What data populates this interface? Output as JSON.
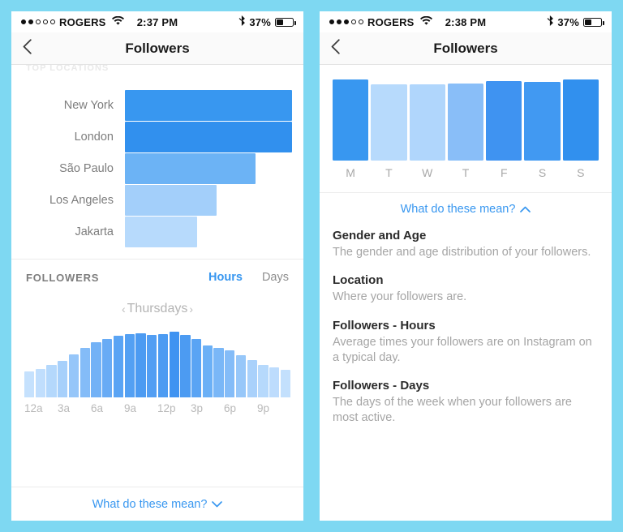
{
  "background_color": "#7ed8f2",
  "accent_color": "#3897f0",
  "left_phone": {
    "status_bar": {
      "carrier": "ROGERS",
      "signal_dots_filled": 2,
      "signal_dots_total": 5,
      "wifi_icon": "wifi-icon",
      "time": "2:37 PM",
      "bluetooth_icon": "bluetooth-icon",
      "battery_percent": "37%"
    },
    "nav": {
      "back_icon": "chevron-left-icon",
      "title": "Followers"
    },
    "cut_heading": "TOP LOCATIONS",
    "locations_section": {
      "rows": [
        {
          "label": "New York",
          "value": 100,
          "color": "#3897f0"
        },
        {
          "label": "London",
          "value": 100,
          "color": "#3190ee"
        },
        {
          "label": "São Paulo",
          "value": 78,
          "color": "#6cb3f5"
        },
        {
          "label": "Los Angeles",
          "value": 55,
          "color": "#a3cffa"
        },
        {
          "label": "Jakarta",
          "value": 43,
          "color": "#b7dafc"
        }
      ]
    },
    "followers_section": {
      "title": "FOLLOWERS",
      "tabs": [
        {
          "label": "Hours",
          "active": true
        },
        {
          "label": "Days",
          "active": false
        }
      ],
      "day_selector": {
        "prev_icon": "chevron-left-icon",
        "label": "Thursdays",
        "next_icon": "chevron-right-icon"
      }
    },
    "expander": {
      "label": "What do these mean?",
      "caret_icon": "chevron-down-icon",
      "caret": "⌄"
    }
  },
  "right_phone": {
    "status_bar": {
      "carrier": "ROGERS",
      "signal_dots_filled": 3,
      "signal_dots_total": 5,
      "wifi_icon": "wifi-icon",
      "time": "2:38 PM",
      "bluetooth_icon": "bluetooth-icon",
      "battery_percent": "37%"
    },
    "nav": {
      "back_icon": "chevron-left-icon",
      "title": "Followers"
    },
    "expander": {
      "label": "What do these mean?",
      "caret_icon": "chevron-up-icon",
      "caret": "⌃"
    },
    "glossary": [
      {
        "term": "Gender and Age",
        "definition": "The gender and age distribution of your followers."
      },
      {
        "term": "Location",
        "definition": "Where your followers are."
      },
      {
        "term": "Followers - Hours",
        "definition": "Average times your followers are on Instagram on a typical day."
      },
      {
        "term": "Followers - Days",
        "definition": "The days of the week when your followers are most active."
      }
    ]
  },
  "chart_data": [
    {
      "type": "bar",
      "title": "TOP LOCATIONS",
      "orientation": "horizontal",
      "categories": [
        "New York",
        "London",
        "São Paulo",
        "Los Angeles",
        "Jakarta"
      ],
      "values": [
        100,
        100,
        78,
        55,
        43
      ],
      "colors": [
        "#3897f0",
        "#3190ee",
        "#6cb3f5",
        "#a3cffa",
        "#b7dafc"
      ],
      "xlabel": "",
      "ylabel": "",
      "xlim": [
        0,
        100
      ],
      "grid": false,
      "legend": false
    },
    {
      "type": "bar",
      "title": "FOLLOWERS — Hours",
      "subtitle": "Thursdays",
      "x": [
        "12a",
        "1a",
        "2a",
        "3a",
        "4a",
        "5a",
        "6a",
        "7a",
        "8a",
        "9a",
        "10a",
        "11a",
        "12p",
        "1p",
        "2p",
        "3p",
        "4p",
        "5p",
        "6p",
        "7p",
        "8p",
        "9p",
        "10p",
        "11p"
      ],
      "tick_labels": [
        "12a",
        "3a",
        "6a",
        "9a",
        "12p",
        "3p",
        "6p",
        "9p"
      ],
      "values": [
        35,
        38,
        43,
        49,
        58,
        66,
        74,
        78,
        83,
        85,
        86,
        84,
        85,
        88,
        84,
        78,
        70,
        66,
        63,
        57,
        50,
        44,
        40,
        37
      ],
      "colors": [
        "#c5e1fd",
        "#c0defd",
        "#b4d8fc",
        "#a7d0fb",
        "#96c6f9",
        "#84bcf8",
        "#73b2f6",
        "#68abf5",
        "#5aa4f4",
        "#53a0f3",
        "#4c9bf2",
        "#529ef3",
        "#4c9bf2",
        "#3f93f1",
        "#4c9bf2",
        "#5aa4f4",
        "#6bb0f6",
        "#7ab7f7",
        "#84bcf8",
        "#97c7f9",
        "#a9d1fb",
        "#b6d9fc",
        "#bddcfd",
        "#c3e0fd"
      ],
      "ylim": [
        0,
        100
      ],
      "grid": false,
      "legend": false,
      "xlabel": "",
      "ylabel": ""
    },
    {
      "type": "bar",
      "title": "FOLLOWERS — Days",
      "categories": [
        "M",
        "T",
        "W",
        "T",
        "F",
        "S",
        "S"
      ],
      "values": [
        100,
        94,
        94,
        95,
        98,
        97,
        100
      ],
      "colors": [
        "#3897f0",
        "#b7dafc",
        "#b0d6fc",
        "#89bef8",
        "#3f93f1",
        "#4199f2",
        "#3190ee"
      ],
      "ylim": [
        0,
        100
      ],
      "grid": false,
      "legend": false,
      "xlabel": "",
      "ylabel": ""
    }
  ]
}
